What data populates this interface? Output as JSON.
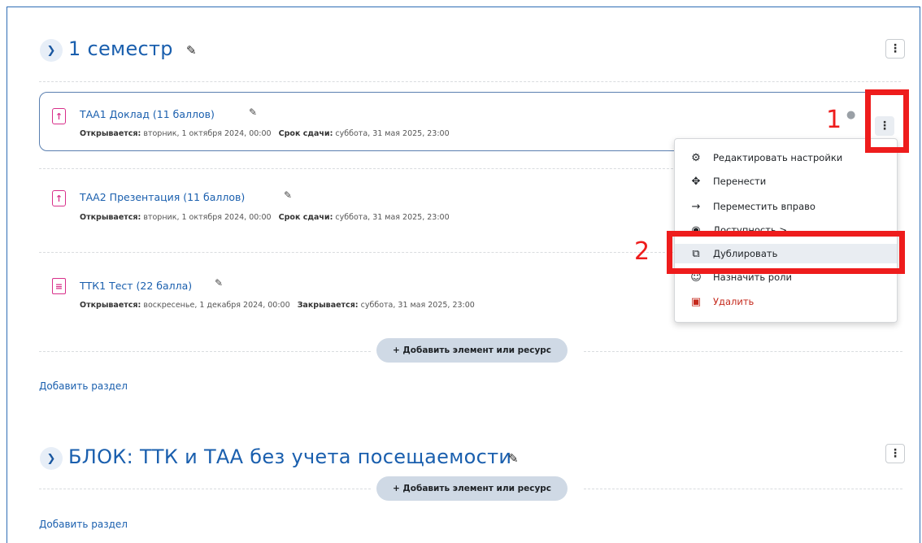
{
  "section1": {
    "title": "1 семестр",
    "activities": [
      {
        "name": "ТАА1 Доклад (11 баллов)",
        "open_label": "Открывается:",
        "open_value": "вторник, 1 октября 2024, 00:00",
        "due_label": "Срок сдачи:",
        "due_value": "суббота, 31 мая 2025, 23:00",
        "icon": "assignment-icon"
      },
      {
        "name": "ТАА2 Презентация (11 баллов)",
        "open_label": "Открывается:",
        "open_value": "вторник, 1 октября 2024, 00:00",
        "due_label": "Срок сдачи:",
        "due_value": "суббота, 31 мая 2025, 23:00",
        "icon": "assignment-icon"
      },
      {
        "name": "ТТК1 Тест (22 балла)",
        "open_label": "Открывается:",
        "open_value": "воскресенье, 1 декабря 2024, 00:00",
        "due_label": "Закрывается:",
        "due_value": "суббота, 31 мая 2025, 23:00",
        "icon": "quiz-icon"
      }
    ],
    "add_activity": "+ Добавить элемент или ресурс",
    "add_section": "Добавить раздел"
  },
  "section2": {
    "title": "БЛОК: ТТК и ТАА без учета посещаемости",
    "add_activity": "+ Добавить элемент или ресурс",
    "add_section": "Добавить раздел"
  },
  "menu": {
    "items": [
      {
        "label": "Редактировать настройки",
        "icon": "gear-icon"
      },
      {
        "label": "Перенести",
        "icon": "move-icon"
      },
      {
        "label": "Переместить вправо",
        "icon": "arrow-right-icon"
      },
      {
        "label": "Доступность >",
        "icon": "eye-icon"
      },
      {
        "label": "Дублировать",
        "icon": "duplicate-icon"
      },
      {
        "label": "Назначить роли",
        "icon": "user-icon"
      },
      {
        "label": "Удалить",
        "icon": "trash-icon"
      }
    ]
  },
  "annotations": {
    "label1": "1",
    "label2": "2",
    "color": "#ee1c1c"
  },
  "colors": {
    "link": "#1a5fae",
    "assignment": "#d82f8a",
    "delete": "#c5291c"
  }
}
